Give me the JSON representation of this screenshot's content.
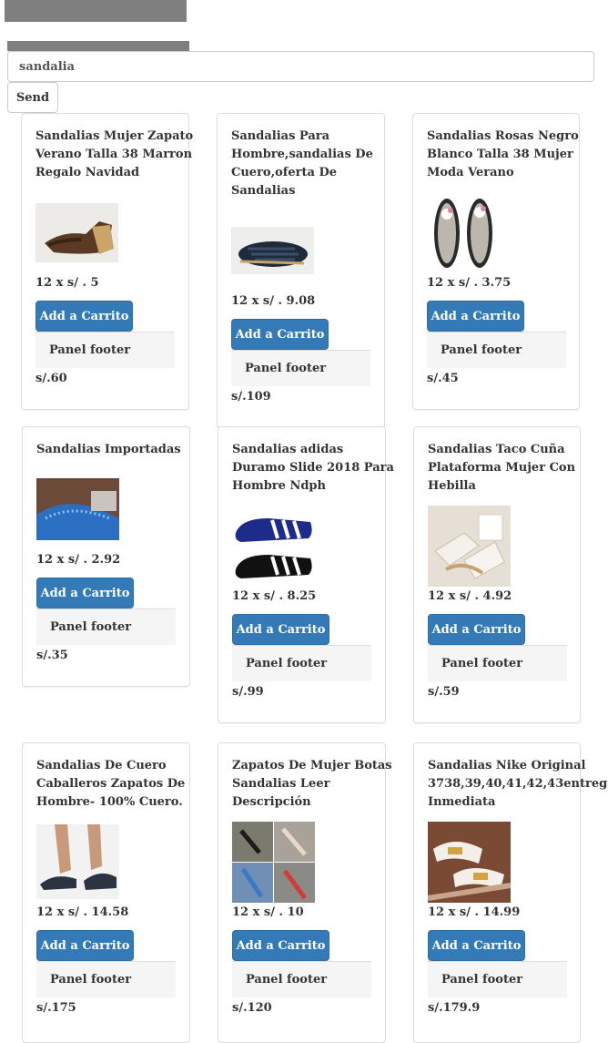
{
  "search": {
    "value": "sandalia"
  },
  "send_label": "Send",
  "button_label": "Add a Carrito",
  "footer_label": "Panel footer",
  "products": [
    {
      "title": [
        "Sandalias Mujer Zapato",
        "Verano Talla 38 Marron",
        "Regalo Navidad"
      ],
      "price": "12 x s/ . 5",
      "total": "s/.60",
      "image": "brown-wedge-sandal"
    },
    {
      "title": [
        "Sandalias Para",
        "Hombre,sandalias De",
        "Cuero,oferta De",
        "Sandalias"
      ],
      "price": "12 x s/ . 9.08",
      "total": "s/.109",
      "image": "blue-leather-sandal"
    },
    {
      "title": [
        "Sandalias Rosas Negro",
        "Blanco Talla 38 Mujer",
        "Moda Verano"
      ],
      "price": "12 x s/ . 3.75",
      "total": "s/.45",
      "image": "floral-flip-flops"
    },
    {
      "title": [
        "Sandalias Importadas"
      ],
      "price": "12 x s/ . 2.92",
      "total": "s/.35",
      "image": "blue-sparkle-sandal"
    },
    {
      "title": [
        "Sandalias adidas",
        "Duramo Slide 2018 Para",
        "Hombre Ndph"
      ],
      "price": "12 x s/ . 8.25",
      "total": "s/.99",
      "image": "adidas-slides"
    },
    {
      "title": [
        "Sandalias Taco Cuña",
        "Plataforma Mujer Con",
        "Hebilla"
      ],
      "price": "12 x s/ . 4.92",
      "total": "s/.59",
      "image": "white-platform-sandals"
    },
    {
      "title": [
        "Sandalias De Cuero",
        "Caballeros Zapatos De",
        "Hombre- 100% Cuero."
      ],
      "price": "12 x s/ . 14.58",
      "total": "s/.175",
      "image": "mens-leather-sandal"
    },
    {
      "title": [
        "Zapatos De Mujer Botas",
        "Sandalias Leer",
        "Descripción"
      ],
      "price": "12 x s/ . 10",
      "total": "s/.120",
      "image": "heeled-sandals-collage"
    },
    {
      "title": [
        "Sandalias Nike Original",
        "3738,39,40,41,42,43entrega",
        "Inmediata"
      ],
      "price": "12 x s/ . 14.99",
      "total": "s/.179.9",
      "image": "nike-sandals"
    }
  ]
}
